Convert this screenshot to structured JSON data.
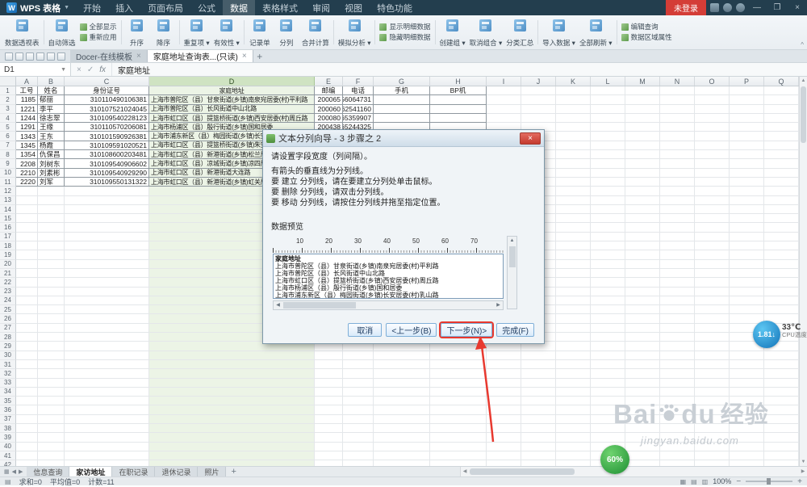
{
  "titlebar": {
    "logo_letter": "W",
    "logo_text": "WPS 表格",
    "menus": [
      "开始",
      "插入",
      "页面布局",
      "公式",
      "数据",
      "表格样式",
      "审阅",
      "视图",
      "特色功能"
    ],
    "active_menu": "数据",
    "login_label": "未登录",
    "window": {
      "min": "—",
      "max": "❐",
      "close": "×"
    }
  },
  "ribbon": {
    "groups": [
      {
        "items": [
          {
            "name": "pivot-table",
            "label": "数据透视表",
            "big": true
          }
        ]
      },
      {
        "items": [
          {
            "name": "auto-filter",
            "label": "自动筛选",
            "big": true
          },
          {
            "stack": [
              {
                "name": "show-all",
                "label": "全部显示"
              },
              {
                "name": "reapply",
                "label": "重新应用"
              }
            ]
          }
        ]
      },
      {
        "items": [
          {
            "name": "sort-asc",
            "label": "升序",
            "big": true
          },
          {
            "name": "sort-desc",
            "label": "降序",
            "big": true
          }
        ]
      },
      {
        "items": [
          {
            "name": "highlight-duplicates",
            "label": "重复项",
            "big": true,
            "arrow": true
          },
          {
            "name": "validation",
            "label": "有效性",
            "big": true,
            "arrow": true
          }
        ]
      },
      {
        "items": [
          {
            "name": "record-form",
            "label": "记录单",
            "big": true
          },
          {
            "name": "text-to-columns",
            "label": "分列",
            "big": true
          },
          {
            "name": "consolidate",
            "label": "合并计算",
            "big": true
          }
        ]
      },
      {
        "items": [
          {
            "name": "what-if-analysis",
            "label": "模拟分析",
            "big": true,
            "arrow": true
          }
        ]
      },
      {
        "items": [
          {
            "stack": [
              {
                "name": "show-detail",
                "label": "显示明细数据"
              },
              {
                "name": "hide-detail",
                "label": "隐藏明细数据"
              }
            ]
          }
        ]
      },
      {
        "items": [
          {
            "name": "group",
            "label": "创建组",
            "big": true,
            "arrow": true
          },
          {
            "name": "ungroup",
            "label": "取消组合",
            "big": true,
            "arrow": true
          },
          {
            "name": "subtotal",
            "label": "分类汇总",
            "big": true
          }
        ]
      },
      {
        "items": [
          {
            "name": "import-data",
            "label": "导入数据",
            "big": true,
            "arrow": true
          },
          {
            "name": "refresh-all",
            "label": "全部刷新",
            "big": true,
            "arrow": true
          }
        ]
      },
      {
        "items": [
          {
            "stack": [
              {
                "name": "edit-query",
                "label": "编辑查询"
              },
              {
                "name": "data-range-properties",
                "label": "数据区域属性"
              }
            ]
          }
        ]
      }
    ]
  },
  "quickbar_icons": [
    "new-file-icon",
    "save-icon",
    "print-icon",
    "print-preview-icon",
    "undo-icon",
    "redo-icon"
  ],
  "doc_tabs": [
    {
      "label": "Docer-在线模板",
      "active": false
    },
    {
      "label": "家庭地址查询表...(只读)",
      "active": true
    }
  ],
  "doc_tab_add": "+",
  "formula_bar": {
    "name_box": "D1",
    "cancel_glyph": "×",
    "confirm_glyph": "✓",
    "fx": "fx",
    "content": "家庭地址"
  },
  "grid": {
    "col_letters": [
      "A",
      "B",
      "C",
      "D",
      "E",
      "F",
      "G",
      "H",
      "I",
      "J",
      "K",
      "L",
      "M",
      "N",
      "O",
      "P",
      "Q"
    ],
    "selected_col": "D",
    "row_count": 42,
    "table": {
      "headers": [
        "工号",
        "姓名",
        "身份证号",
        "家庭地址",
        "邮编",
        "电话",
        "手机",
        "BP机"
      ],
      "rows": [
        [
          "1185",
          "郁丽",
          "310110490106381",
          "上海市普陀区（县）甘泉街道(乡镇)南泉宛居委(村)平利路",
          "200065",
          "56064731",
          "",
          ""
        ],
        [
          "1221",
          "李平",
          "310107521024045",
          "上海市普陀区（县）长风街道中山北路",
          "200060",
          "62541160",
          "",
          ""
        ],
        [
          "1244",
          "徐志翠",
          "310109540228123",
          "上海市虹口区（县）提篮桥街道(乡镇)西安居委(村)周丘路",
          "200080",
          "65359907",
          "",
          ""
        ],
        [
          "1291",
          "王缘",
          "310110570206081",
          "上海市杨浦区（县）殷行街道(乡镇)国和居委",
          "200438",
          "65244325",
          "",
          ""
        ],
        [
          "1343",
          "王东",
          "310101590926381",
          "上海市浦东新区（县）梅园街道(乡镇)长安居委(村)乳山路",
          "",
          "",
          "",
          ""
        ],
        [
          "1345",
          "杨霞",
          "310109591020521",
          "上海市虹口区（县）提篮桥街道(乡镇)朱安居委(村)梧州路",
          "",
          "",
          "",
          ""
        ],
        [
          "1354",
          "仇保昌",
          "310108600203481",
          "上海市虹口区（县）新港街道(乡镇)松兰居委(村)昆明路",
          "",
          "",
          "",
          ""
        ],
        [
          "2208",
          "刘树东",
          "310109540906602",
          "上海市虹口区（县）凉城街道(乡镇)凉四居委",
          "",
          "",
          "",
          ""
        ],
        [
          "2210",
          "刘素彬",
          "310109540929290",
          "上海市虹口区（县）新港街道大连路",
          "",
          "",
          "",
          ""
        ],
        [
          "2220",
          "刘军",
          "310109550131322",
          "上海市虹口区（县）新港街道(乡镇)虹关居委",
          "",
          "",
          "",
          ""
        ]
      ]
    }
  },
  "dialog": {
    "title": "文本分列向导 - 3 步骤之 2",
    "close_glyph": "×",
    "instructions": [
      "请设置字段宽度（列间隔）。",
      "有箭头的垂直线为分列线。",
      "要  建立  分列线，请在要建立分列处单击鼠标。",
      "要  删除  分列线，请双击分列线。",
      "要  移动  分列线，请按住分列线并拖至指定位置。"
    ],
    "preview_label": "数据预览",
    "ruler_ticks": [
      "10",
      "20",
      "30",
      "40",
      "50",
      "60",
      "70"
    ],
    "preview_lines": [
      "家庭地址",
      "上海市普陀区（县）甘泉街道(乡镇)南泉宛居委(村)平利路",
      "上海市普陀区（县）长风街道中山北路",
      "上海市虹口区（县）提篮桥街道(乡镇)西安居委(村)周丘路",
      "上海市杨浦区（县）殷行街道(乡镇)国和居委",
      "上海市浦东新区（县）梅园街道(乡镇)长安居委(村)乳山路"
    ],
    "buttons": {
      "cancel": "取消",
      "back": "<上一步(B)",
      "next": "下一步(N)>",
      "finish": "完成(F)"
    }
  },
  "sheet_bar": {
    "tabs": [
      "信息查询",
      "家访地址",
      "在职记录",
      "退休记录",
      "照片"
    ],
    "active": "家访地址",
    "add": "+"
  },
  "status_bar": {
    "sum": "求和=0",
    "avg": "平均值=0",
    "count": "计数=11",
    "zoom": "100%",
    "zoom_out": "−",
    "zoom_in": "+"
  },
  "widgets": {
    "blue_ball": "1.81↓",
    "cpu_temp": "33℃",
    "cpu_temp_label": "CPU温度",
    "green_ball": "60%"
  },
  "watermark": {
    "brand_left": "Bai",
    "brand_right": "du",
    "brand_cn": "经验",
    "url": "jingyan.baidu.com"
  },
  "colors": {
    "accent_red": "#e8392f",
    "selection_green": "#cfe3c2",
    "titlebar": "#233e4e"
  }
}
